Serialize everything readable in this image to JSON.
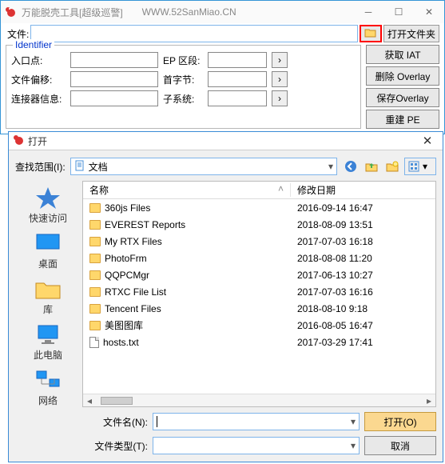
{
  "main": {
    "title": "万能脱壳工具[超级巡警]",
    "url": "WWW.52SanMiao.CN",
    "file_label": "文件:",
    "file_value": "",
    "open_folder": "打开文件夹",
    "group_title": "Identifier",
    "fields": {
      "entry_label": "入口点:",
      "entry_value": "",
      "ep_label": "EP 区段:",
      "ep_value": "",
      "offset_label": "文件偏移:",
      "offset_value": "",
      "firstbyte_label": "首字节:",
      "firstbyte_value": "",
      "linker_label": "连接器信息:",
      "linker_value": "",
      "subsys_label": "子系统:",
      "subsys_value": ""
    },
    "buttons": {
      "get_iat": "获取 IAT",
      "del_overlay": "删除 Overlay",
      "save_overlay": "保存Overlay",
      "rebuild_pe": "重建 PE"
    }
  },
  "dialog": {
    "title": "打开",
    "lookin_label": "查找范围(I):",
    "lookin_value": "文档",
    "cols": {
      "name": "名称",
      "date": "修改日期"
    },
    "places": {
      "quick": "快速访问",
      "desktop": "桌面",
      "lib": "库",
      "pc": "此电脑",
      "net": "网络"
    },
    "rows": [
      {
        "type": "folder",
        "name": "360js Files",
        "date": "2016-09-14 16:47"
      },
      {
        "type": "folder",
        "name": "EVEREST Reports",
        "date": "2018-08-09 13:51"
      },
      {
        "type": "folder",
        "name": "My RTX Files",
        "date": "2017-07-03 16:18"
      },
      {
        "type": "folder",
        "name": "PhotoFrm",
        "date": "2018-08-08 11:20"
      },
      {
        "type": "folder",
        "name": "QQPCMgr",
        "date": "2017-06-13 10:27"
      },
      {
        "type": "folder",
        "name": "RTXC File List",
        "date": "2017-07-03 16:16"
      },
      {
        "type": "folder",
        "name": "Tencent Files",
        "date": "2018-08-10 9:18"
      },
      {
        "type": "folder",
        "name": "美图图库",
        "date": "2016-08-05 16:47"
      },
      {
        "type": "file",
        "name": "hosts.txt",
        "date": "2017-03-29 17:41"
      }
    ],
    "filename_label": "文件名(N):",
    "filename_value": "",
    "filetype_label": "文件类型(T):",
    "filetype_value": "",
    "open_btn": "打开(O)",
    "cancel_btn": "取消"
  }
}
